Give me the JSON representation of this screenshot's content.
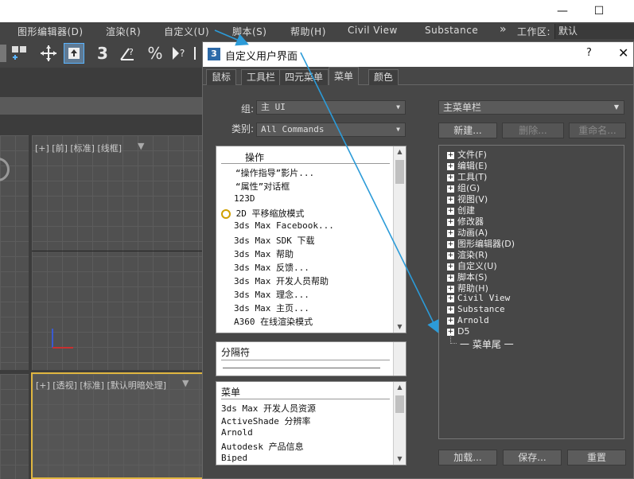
{
  "menubar": {
    "items": [
      "图形编辑器(D)",
      "渲染(R)",
      "自定义(U)",
      "脚本(S)",
      "帮助(H)",
      "Civil View",
      "Substance"
    ],
    "overflow": "»",
    "workspace_label": "工作区:",
    "workspace_value": "默认"
  },
  "viewports": {
    "front_label": "[+] [前] [标准] [线框]",
    "persp_label": "[+] [透视] [标准] [默认明暗处理]",
    "persp_filter": "▼",
    "front_filter": "▼"
  },
  "dialog": {
    "title": "自定义用户界面",
    "help": "?",
    "close": "✕",
    "icon_text": "3",
    "tabs": [
      "鼠标",
      "工具栏",
      "四元菜单",
      "菜单",
      "颜色"
    ],
    "active_tab": "菜单",
    "group_label": "组:",
    "group_value": "主 UI",
    "category_label": "类别:",
    "category_value": "All Commands",
    "actions_header": "操作",
    "actions": [
      "“操作指导”影片...",
      "“属性”对话框",
      "123D",
      "2D 平移缩放模式",
      "3ds Max Facebook...",
      "3ds Max SDK 下载",
      "3ds Max 帮助",
      "3ds Max 反馈...",
      "3ds Max 开发人员帮助",
      "3ds Max 理念...",
      "3ds Max 主页...",
      "A360 在线渲染模式"
    ],
    "separator_header": "分隔符",
    "menus_header": "菜单",
    "menus": [
      "3ds Max 开发人员资源",
      "ActiveShade 分辨率",
      "Arnold",
      "Autodesk 产品信息",
      "Biped"
    ],
    "right_combo": "主菜单栏",
    "new_btn": "新建...",
    "delete_btn": "删除...",
    "rename_btn": "重命名...",
    "tree_items": [
      "文件(F)",
      "编辑(E)",
      "工具(T)",
      "组(G)",
      "视图(V)",
      "创建",
      "修改器",
      "动画(A)",
      "图形编辑器(D)",
      "渲染(R)",
      "自定义(U)",
      "脚本(S)",
      "帮助(H)",
      "Civil View",
      "Substance",
      "Arnold",
      "D5"
    ],
    "tree_end": "一 菜单尾 一",
    "load_btn": "加载...",
    "save_btn": "保存...",
    "reset_btn": "重置"
  },
  "window": {
    "minimize": "—",
    "maximize": "☐"
  },
  "colors": {
    "arrow": "#2c9bd8",
    "dialog_bg": "#474747",
    "app_bg": "#444444"
  }
}
